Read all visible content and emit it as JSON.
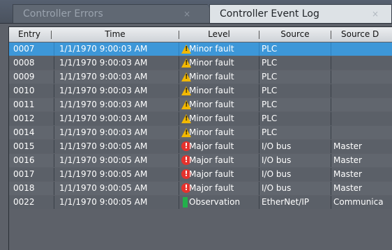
{
  "tabs": [
    {
      "label": "Controller Errors",
      "close": "×",
      "active": false
    },
    {
      "label": "Controller Event Log",
      "close": "×",
      "active": true
    }
  ],
  "columns": [
    "Entry",
    "Time",
    "Level",
    "Source",
    "Source D"
  ],
  "rows": [
    {
      "entry": "0007",
      "time": "1/1/1970 9:00:03 AM",
      "level": "Minor fault",
      "level_icon": "warning-icon",
      "source": "PLC",
      "source_detail": "",
      "selected": true
    },
    {
      "entry": "0008",
      "time": "1/1/1970 9:00:03 AM",
      "level": "Minor fault",
      "level_icon": "warning-icon",
      "source": "PLC",
      "source_detail": ""
    },
    {
      "entry": "0009",
      "time": "1/1/1970 9:00:03 AM",
      "level": "Minor fault",
      "level_icon": "warning-icon",
      "source": "PLC",
      "source_detail": ""
    },
    {
      "entry": "0010",
      "time": "1/1/1970 9:00:03 AM",
      "level": "Minor fault",
      "level_icon": "warning-icon",
      "source": "PLC",
      "source_detail": ""
    },
    {
      "entry": "0011",
      "time": "1/1/1970 9:00:03 AM",
      "level": "Minor fault",
      "level_icon": "warning-icon",
      "source": "PLC",
      "source_detail": ""
    },
    {
      "entry": "0012",
      "time": "1/1/1970 9:00:03 AM",
      "level": "Minor fault",
      "level_icon": "warning-icon",
      "source": "PLC",
      "source_detail": ""
    },
    {
      "entry": "0014",
      "time": "1/1/1970 9:00:03 AM",
      "level": "Minor fault",
      "level_icon": "warning-icon",
      "source": "PLC",
      "source_detail": ""
    },
    {
      "entry": "0015",
      "time": "1/1/1970 9:00:05 AM",
      "level": "Major fault",
      "level_icon": "error-icon",
      "source": "I/O bus",
      "source_detail": "Master"
    },
    {
      "entry": "0016",
      "time": "1/1/1970 9:00:05 AM",
      "level": "Major fault",
      "level_icon": "error-icon",
      "source": "I/O bus",
      "source_detail": "Master"
    },
    {
      "entry": "0017",
      "time": "1/1/1970 9:00:05 AM",
      "level": "Major fault",
      "level_icon": "error-icon",
      "source": "I/O bus",
      "source_detail": "Master"
    },
    {
      "entry": "0018",
      "time": "1/1/1970 9:00:05 AM",
      "level": "Major fault",
      "level_icon": "error-icon",
      "source": "I/O bus",
      "source_detail": "Master"
    },
    {
      "entry": "0022",
      "time": "1/1/1970 9:00:05 AM",
      "level": "Observation",
      "level_icon": "observation-icon",
      "source": "EtherNet/IP",
      "source_detail": "Communica"
    }
  ],
  "colors": {
    "selected_row": "#3d97d8",
    "warning": "#f2b800",
    "error": "#e5322d",
    "observation": "#23b04b"
  }
}
